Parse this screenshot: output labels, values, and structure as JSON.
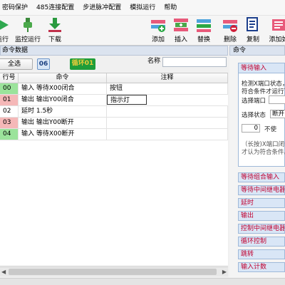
{
  "menubar": {
    "items": [
      "密码保护",
      "485连接配置",
      "步进脉冲配置",
      "模拟运行",
      "帮助"
    ]
  },
  "toolbar": {
    "run_label": "运行",
    "monitor_run_label": "监控运行",
    "download_label": "下载",
    "add_label": "添加",
    "insert_label": "插入",
    "replace_label": "替换",
    "delete_label": "删除",
    "copy_label": "复制",
    "add_if_label": "添加如"
  },
  "left_panel": {
    "title": "命令数据",
    "select_all_label": "全选",
    "count_badge": "06",
    "loop_badge": "循环01",
    "name_label": "名称",
    "name_value": ""
  },
  "table": {
    "columns": [
      "行号",
      "命令",
      "注释"
    ],
    "rows": [
      {
        "line": "00",
        "cmd": "输入 等待X00闭合",
        "note": "按钮",
        "color": "#9be39b"
      },
      {
        "line": "01",
        "cmd": "输出 输出Y00闭合",
        "note": "指示灯",
        "color": "#f5b8b8"
      },
      {
        "line": "02",
        "cmd": "延时 1.5秒",
        "note": "",
        "color": "#ffffff"
      },
      {
        "line": "03",
        "cmd": "输出 输出Y00断开",
        "note": "",
        "color": "#f5b8b8"
      },
      {
        "line": "04",
        "cmd": "输入 等待X00断开",
        "note": "",
        "color": "#9be39b"
      }
    ]
  },
  "right_panel": {
    "title": "命令",
    "card_title": "等待输入",
    "desc_line1": "检测X端口状态，",
    "desc_line2": "符合条件才运行下",
    "select_port_label": "选择端口",
    "select_status_label": "选择状态",
    "status_value": "断开",
    "spin_value": "0",
    "spin_unit": "不使",
    "note_line1": "（长按)X端口闭合",
    "note_line2": "才认为符合条件。",
    "categories": [
      "等待组合输入",
      "等待中间继电器",
      "延时",
      "输出",
      "控制中间继电器",
      "循环控制",
      "跳转",
      "输入计数"
    ]
  },
  "colors": {
    "accent": "#c00030",
    "badge_blue": "#2c6fb8",
    "badge_green": "#2aa844",
    "loop_bg": "#1f9d3a",
    "loop_text": "#e8cc3a",
    "row_input": "#9be39b",
    "row_output": "#f5b8b8"
  }
}
